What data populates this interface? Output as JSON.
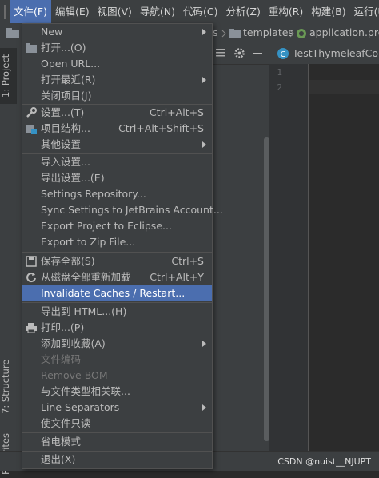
{
  "menubar": {
    "items": [
      "文件(F)",
      "编辑(E)",
      "视图(V)",
      "导航(N)",
      "代码(C)",
      "分析(Z)",
      "重构(R)",
      "构建(B)",
      "运行(U)"
    ]
  },
  "navbar": {
    "crumbs": [
      "s",
      "templates",
      "application.prop"
    ]
  },
  "left_tabs": {
    "project": "1: Project",
    "structure": "7: Structure",
    "favorites": "Favorites"
  },
  "editor": {
    "tab_label": "TestThymeleafContr",
    "line_numbers": [
      "1",
      "2"
    ]
  },
  "file_menu": {
    "new": "New",
    "open": "打开...(O)",
    "open_url": "Open URL...",
    "open_recent": "打开最近(R)",
    "close_project": "关闭项目(J)",
    "settings": "设置...(T)",
    "settings_sc": "Ctrl+Alt+S",
    "project_structure": "项目结构...",
    "project_structure_sc": "Ctrl+Alt+Shift+S",
    "other_settings": "其他设置",
    "import_settings": "导入设置...",
    "export_settings": "导出设置...(E)",
    "settings_repository": "Settings Repository...",
    "sync_settings": "Sync Settings to JetBrains Account...",
    "export_eclipse": "Export Project to Eclipse...",
    "export_zip": "Export to Zip File...",
    "save_all": "保存全部(S)",
    "save_all_sc": "Ctrl+S",
    "reload_all": "从磁盘全部重新加载",
    "reload_all_sc": "Ctrl+Alt+Y",
    "invalidate_caches": "Invalidate Caches / Restart...",
    "export_html": "导出到 HTML...(H)",
    "print": "打印...(P)",
    "add_to_favorites": "添加到收藏(A)",
    "file_encoding": "文件编码",
    "remove_bom": "Remove BOM",
    "associate_file_type": "与文件类型相关联...",
    "line_separators": "Line Separators",
    "make_read_only": "使文件只读",
    "power_save_mode": "省电模式",
    "exit": "退出(X)"
  },
  "status": {
    "watermark": "CSDN @nuist__NJUPT"
  },
  "colors": {
    "highlight": "#4b6eaf",
    "menu_bg": "#3c3f41",
    "editor_bg": "#2b2b2b"
  }
}
